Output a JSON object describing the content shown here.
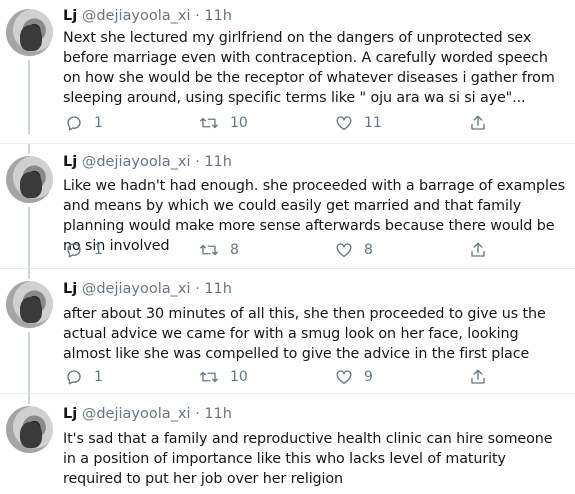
{
  "tweets": [
    {
      "name": "Lj",
      "handle": "@dejiayoola_xi",
      "dot": "·",
      "time": "11h",
      "text": "Next she lectured my girlfriend on the dangers of unprotected sex before marriage even with contraception. A carefully worded speech on how she would be the receptor of whatever diseases i gather from sleeping around, using specific terms like \" oju ara wa si si aye\"...",
      "replies": "1",
      "retweets": "10",
      "likes": "11"
    },
    {
      "name": "Lj",
      "handle": "@dejiayoola_xi",
      "dot": "·",
      "time": "11h",
      "text": "Like we hadn't had enough. she proceeded with a barrage of examples and means by which we could easily get married and that family planning would make more sense afterwards because there would be no sin involved",
      "replies": "1",
      "retweets": "8",
      "likes": "8"
    },
    {
      "name": "Lj",
      "handle": "@dejiayoola_xi",
      "dot": "·",
      "time": "11h",
      "text": "after about 30 minutes of all this, she then proceeded to give us the actual advice we came for with a smug look on her face, looking almost like she was compelled to give the advice in the first place",
      "replies": "1",
      "retweets": "10",
      "likes": "9"
    },
    {
      "name": "Lj",
      "handle": "@dejiayoola_xi",
      "dot": "·",
      "time": "11h",
      "text": "It's sad that a family and reproductive health clinic can hire someone in a position of importance like this who lacks level of maturity required to put her job over her religion"
    }
  ],
  "icons": {
    "reply": "reply-icon",
    "retweet": "retweet-icon",
    "like": "heart-icon",
    "share": "share-icon"
  },
  "colors": {
    "text": "#14171a",
    "secondary": "#657786",
    "thread_line": "#ccd6dd",
    "divider": "#e6ecf0"
  }
}
